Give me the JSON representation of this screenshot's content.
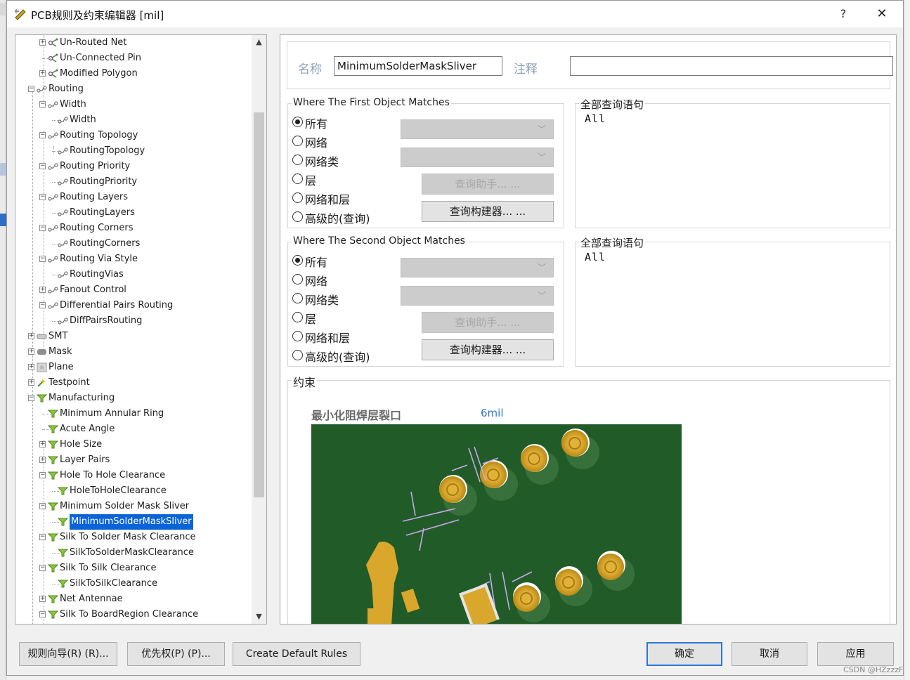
{
  "window": {
    "title": "PCB规则及约束编辑器 [mil]",
    "help_label": "?",
    "close_label": "✕"
  },
  "tree": {
    "selected": "MinimumSolderMaskSliver",
    "nodes": [
      {
        "label": "Un-Routed Net",
        "level": 2,
        "expander": "+",
        "icon": "routing-rule-icon"
      },
      {
        "label": "Un-Connected Pin",
        "level": 2,
        "expander": "",
        "icon": "routing-rule-icon"
      },
      {
        "label": "Modified Polygon",
        "level": 2,
        "expander": "+",
        "icon": "routing-rule-icon"
      },
      {
        "label": "Routing",
        "level": 1,
        "expander": "-",
        "icon": "routing-category-icon"
      },
      {
        "label": "Width",
        "level": 2,
        "expander": "-",
        "icon": "routing-category-icon"
      },
      {
        "label": "Width",
        "level": 3,
        "expander": "",
        "icon": "routing-category-icon"
      },
      {
        "label": "Routing Topology",
        "level": 2,
        "expander": "-",
        "icon": "routing-category-icon"
      },
      {
        "label": "RoutingTopology",
        "level": 3,
        "expander": "",
        "icon": "routing-category-icon"
      },
      {
        "label": "Routing Priority",
        "level": 2,
        "expander": "-",
        "icon": "routing-category-icon"
      },
      {
        "label": "RoutingPriority",
        "level": 3,
        "expander": "",
        "icon": "routing-category-icon"
      },
      {
        "label": "Routing Layers",
        "level": 2,
        "expander": "-",
        "icon": "routing-category-icon"
      },
      {
        "label": "RoutingLayers",
        "level": 3,
        "expander": "",
        "icon": "routing-category-icon"
      },
      {
        "label": "Routing Corners",
        "level": 2,
        "expander": "-",
        "icon": "routing-category-icon"
      },
      {
        "label": "RoutingCorners",
        "level": 3,
        "expander": "",
        "icon": "routing-category-icon"
      },
      {
        "label": "Routing Via Style",
        "level": 2,
        "expander": "-",
        "icon": "routing-category-icon"
      },
      {
        "label": "RoutingVias",
        "level": 3,
        "expander": "",
        "icon": "routing-category-icon"
      },
      {
        "label": "Fanout Control",
        "level": 2,
        "expander": "+",
        "icon": "routing-category-icon"
      },
      {
        "label": "Differential Pairs Routing",
        "level": 2,
        "expander": "-",
        "icon": "routing-category-icon"
      },
      {
        "label": "DiffPairsRouting",
        "level": 3,
        "expander": "",
        "icon": "routing-category-icon"
      },
      {
        "label": "SMT",
        "level": 1,
        "expander": "+",
        "icon": "smt-icon"
      },
      {
        "label": "Mask",
        "level": 1,
        "expander": "+",
        "icon": "mask-icon"
      },
      {
        "label": "Plane",
        "level": 1,
        "expander": "+",
        "icon": "plane-icon"
      },
      {
        "label": "Testpoint",
        "level": 1,
        "expander": "+",
        "icon": "testpoint-icon"
      },
      {
        "label": "Manufacturing",
        "level": 1,
        "expander": "-",
        "icon": "manufacturing-icon"
      },
      {
        "label": "Minimum Annular Ring",
        "level": 2,
        "expander": "",
        "icon": "manufacturing-icon"
      },
      {
        "label": "Acute Angle",
        "level": 2,
        "expander": "",
        "icon": "manufacturing-icon"
      },
      {
        "label": "Hole Size",
        "level": 2,
        "expander": "+",
        "icon": "manufacturing-icon"
      },
      {
        "label": "Layer Pairs",
        "level": 2,
        "expander": "+",
        "icon": "manufacturing-icon"
      },
      {
        "label": "Hole To Hole Clearance",
        "level": 2,
        "expander": "-",
        "icon": "manufacturing-icon"
      },
      {
        "label": "HoleToHoleClearance",
        "level": 3,
        "expander": "",
        "icon": "manufacturing-icon"
      },
      {
        "label": "Minimum Solder Mask Sliver",
        "level": 2,
        "expander": "-",
        "icon": "manufacturing-icon"
      },
      {
        "label": "MinimumSolderMaskSliver",
        "level": 3,
        "expander": "",
        "icon": "manufacturing-icon"
      },
      {
        "label": "Silk To Solder Mask Clearance",
        "level": 2,
        "expander": "-",
        "icon": "manufacturing-icon"
      },
      {
        "label": "SilkToSolderMaskClearance",
        "level": 3,
        "expander": "",
        "icon": "manufacturing-icon"
      },
      {
        "label": "Silk To Silk Clearance",
        "level": 2,
        "expander": "-",
        "icon": "manufacturing-icon"
      },
      {
        "label": "SilkToSilkClearance",
        "level": 3,
        "expander": "",
        "icon": "manufacturing-icon"
      },
      {
        "label": "Net Antennae",
        "level": 2,
        "expander": "+",
        "icon": "manufacturing-icon"
      },
      {
        "label": "Silk To BoardRegion Clearance",
        "level": 2,
        "expander": "-",
        "icon": "manufacturing-icon"
      }
    ]
  },
  "rule": {
    "name_label": "名称",
    "name_value": "MinimumSolderMaskSliver",
    "comment_label": "注释",
    "comment_value": ""
  },
  "first_object": {
    "title": "Where The First Object Matches",
    "options": [
      "所有",
      "网络",
      "网络类",
      "层",
      "网络和层",
      "高级的(查询)"
    ],
    "selected_index": 0,
    "query_helper_label": "查询助手... ...",
    "query_builder_label": "查询构建器... ...",
    "full_query_title": "全部查询语句",
    "full_query_text": "All"
  },
  "second_object": {
    "title": "Where The Second Object Matches",
    "options": [
      "所有",
      "网络",
      "网络类",
      "层",
      "网络和层",
      "高级的(查询)"
    ],
    "selected_index": 0,
    "query_helper_label": "查询助手... ...",
    "query_builder_label": "查询构建器... ...",
    "full_query_title": "全部查询语句",
    "full_query_text": "All"
  },
  "constraint": {
    "title": "约束",
    "label": "最小化阻焊层裂口",
    "value": "6mil"
  },
  "buttons": {
    "rule_wizard": "规则向导(R) (R)...",
    "priorities": "优先权(P) (P)...",
    "create_default_rules": "Create Default Rules",
    "ok": "确定",
    "cancel": "取消",
    "apply": "应用"
  },
  "watermark": "CSDN @HZzzzF",
  "colors": {
    "selection": "#0a64d8",
    "board": "#215b28",
    "pad_gold": "#d9a72c",
    "constraint_value": "#2f78c8",
    "default_button_border": "#2a77d1"
  }
}
